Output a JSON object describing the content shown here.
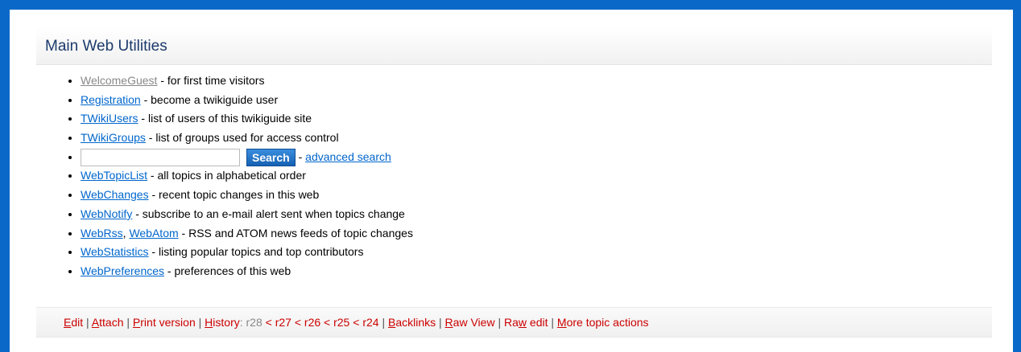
{
  "page": {
    "title": "Main Web Utilities"
  },
  "items": [
    {
      "link": "WelcomeGuest",
      "desc": " - for first time visitors"
    },
    {
      "link": "Registration",
      "desc": " - become a twikiguide user"
    },
    {
      "link": "TWikiUsers",
      "desc": " - list of users of this twikiguide site"
    },
    {
      "link": "TWikiGroups",
      "desc": " - list of groups used for access control"
    },
    {
      "link": "WebTopicList",
      "desc": " - all topics in alphabetical order"
    },
    {
      "link": "WebChanges",
      "desc": " - recent topic changes in this web"
    },
    {
      "link": "WebNotify",
      "desc": " - subscribe to an e-mail alert sent when topics change"
    },
    {
      "link": "WebStatistics",
      "desc": " - listing popular topics and top contributors"
    },
    {
      "link": "WebPreferences",
      "desc": " - preferences of this web"
    }
  ],
  "feeds": {
    "link1": "WebRss",
    "comma": ", ",
    "link2": "WebAtom",
    "desc": " - RSS and ATOM news feeds of topic changes"
  },
  "search": {
    "value": "",
    "button": "Search",
    "sep": " - ",
    "advanced": "advanced search"
  },
  "actions": {
    "edit": {
      "hot": "E",
      "rest": "dit"
    },
    "attach": {
      "hot": "A",
      "rest": "ttach"
    },
    "print": {
      "hot": "P",
      "rest": "rint version"
    },
    "history": {
      "hot": "H",
      "rest": "istory"
    },
    "history_colon": ":",
    "current_rev": "r28",
    "rev_chain": [
      " < r27",
      " < r26",
      " < r25",
      " < r24"
    ],
    "backlinks": {
      "hot": "B",
      "rest": "acklinks"
    },
    "raw_view": {
      "hot": "R",
      "rest": "aw View"
    },
    "raw_edit": {
      "pre": "Ra",
      "hot": "w",
      "rest": " edit"
    },
    "more": {
      "hot": "M",
      "rest": "ore topic actions"
    },
    "sep": " | "
  },
  "colors": {
    "frame": "#0a69c8",
    "link": "#0066cc",
    "action_link": "#cc0000",
    "heading": "#1b3a6b"
  }
}
